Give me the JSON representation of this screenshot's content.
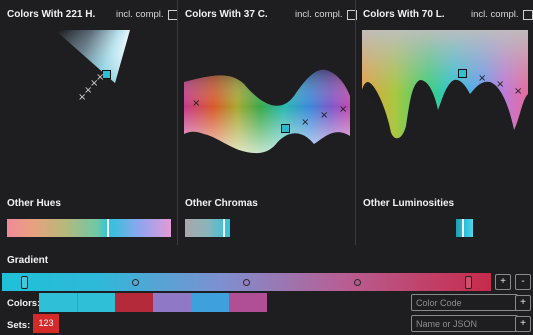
{
  "panels": {
    "hue": {
      "title": "Colors With 221 H.",
      "compl_label": "incl. compl.",
      "other_label": "Other Hues"
    },
    "chroma": {
      "title": "Colors With 37 C.",
      "compl_label": "incl. compl.",
      "other_label": "Other Chromas"
    },
    "luminosity": {
      "title": "Colors With 70 L.",
      "compl_label": "incl. compl.",
      "other_label": "Other Luminosities"
    }
  },
  "gradient": {
    "title": "Gradient",
    "add_label": "+",
    "remove_label": "-"
  },
  "colors": {
    "label": "Colors:",
    "swatches": [
      "#2fbfd6",
      "#2fbfd6",
      "#b52a3a",
      "#8f78c6",
      "#3fa0de",
      "#b04f95"
    ],
    "input_placeholder": "Color Code",
    "add_label": "+"
  },
  "sets": {
    "label": "Sets:",
    "items": [
      "123"
    ],
    "input_placeholder": "Name or JSON",
    "add_label": "+"
  },
  "icons": {
    "x_marker": "x-marker-icon",
    "selected_marker": "selected-square-icon"
  }
}
